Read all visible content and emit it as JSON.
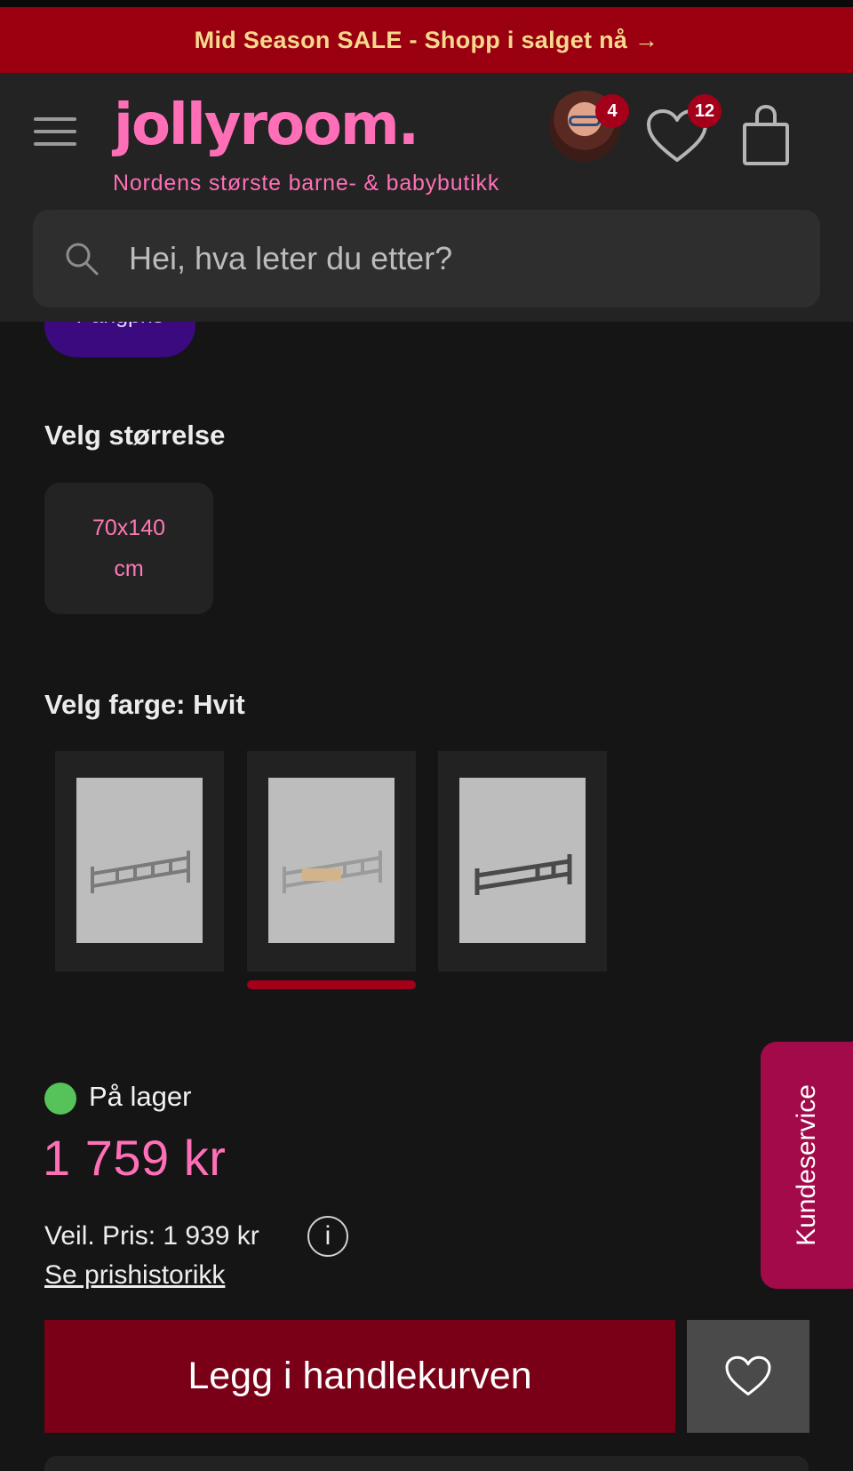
{
  "promo": {
    "text": "Mid Season SALE - Shopp i salget nå →"
  },
  "header": {
    "logo": "jollyroom.",
    "tagline": "Nordens største barne- & babybutikk",
    "avatar_badge": "4",
    "wishlist_badge": "12"
  },
  "search": {
    "placeholder": "Hei, hva leter du etter?"
  },
  "product": {
    "chip": "Pangpris",
    "size_label": "Velg størrelse",
    "size_option": [
      "70x140",
      "cm"
    ],
    "color_label": "Velg farge: Hvit",
    "color_swatches": [
      "grey-bed-image",
      "white-natural-bed-image",
      "dark-grey-bed-image"
    ],
    "selected_swatch_index": 1,
    "stock": "På lager",
    "price": "1 759 kr",
    "recommended_price": "Veil. Pris: 1 939 kr",
    "info_icon": "i",
    "price_history": "Se prishistorikk",
    "add_to_cart": "Legg i handlekurven"
  },
  "support_tab": "Kundeservice",
  "colors": {
    "promo_bg": "#9b0010",
    "promo_text": "#f6d98f",
    "brand_pink": "#ff6fb7",
    "cart_button": "#7a0017",
    "stock_green": "#56c35a",
    "support_tab": "#a30a4a"
  }
}
